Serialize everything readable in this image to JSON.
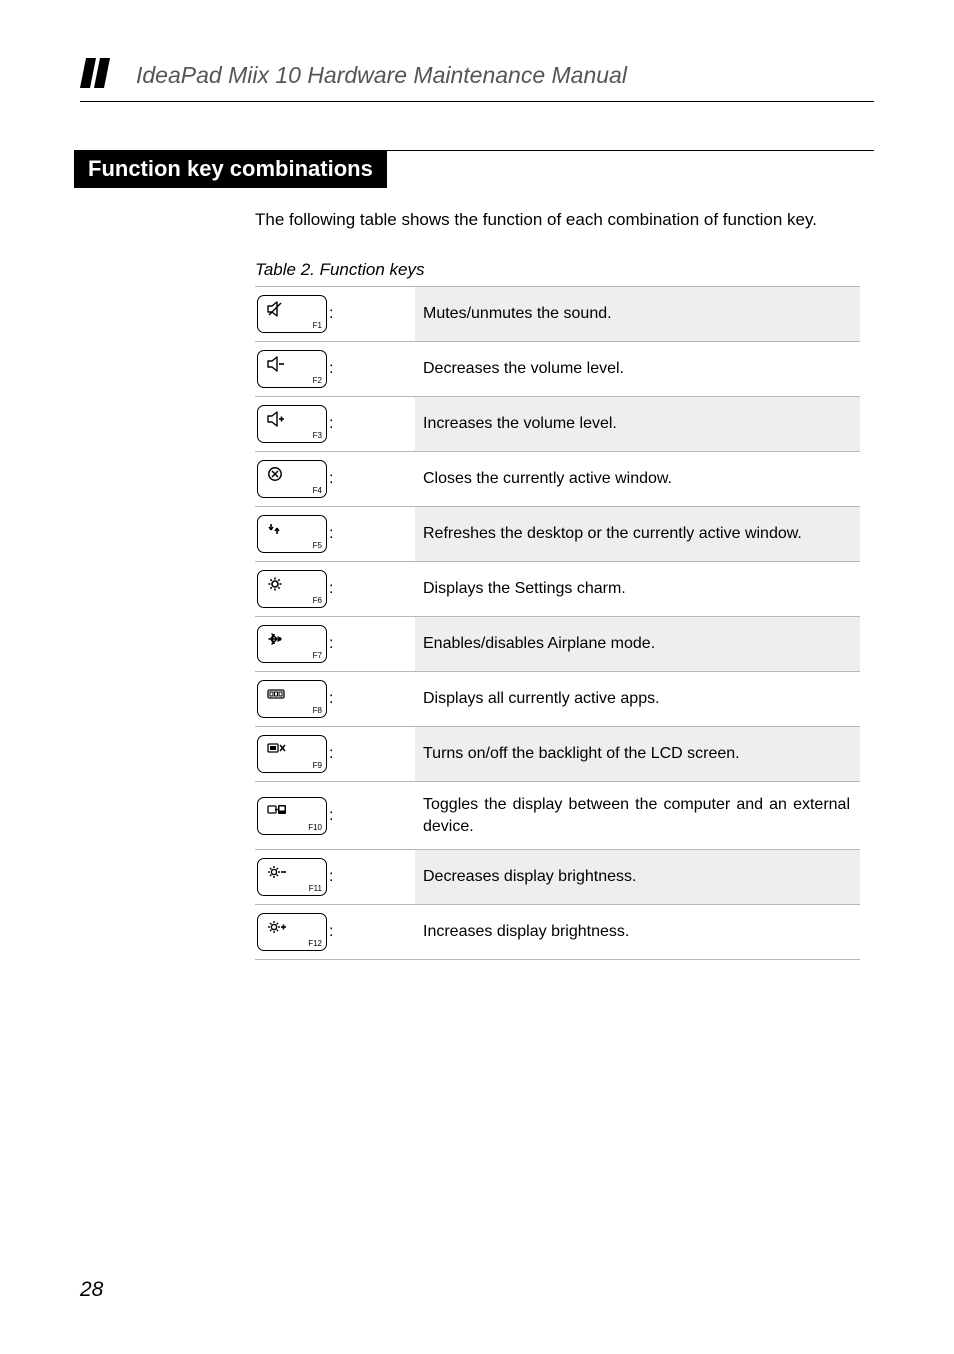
{
  "header": {
    "doc_title": "IdeaPad Miix 10 Hardware Maintenance Manual"
  },
  "section": {
    "heading": "Function key combinations",
    "intro": "The following table shows the function of each combination of function key.",
    "table_caption": "Table 2. Function keys"
  },
  "rows": [
    {
      "fn": "F1",
      "icon": "mute-icon",
      "desc": "Mutes/unmutes the sound.",
      "shaded": true,
      "colon_inside_cell": true
    },
    {
      "fn": "F2",
      "icon": "volume-down-icon",
      "desc": "Decreases the volume level.",
      "shaded": false
    },
    {
      "fn": "F3",
      "icon": "volume-up-icon",
      "desc": "Increases the volume level.",
      "shaded": true
    },
    {
      "fn": "F4",
      "icon": "close-window-icon",
      "desc": "Closes the currently active window.",
      "shaded": false
    },
    {
      "fn": "F5",
      "icon": "refresh-icon",
      "desc": "Refreshes the desktop or the currently active window.",
      "shaded": true
    },
    {
      "fn": "F6",
      "icon": "settings-gear-icon",
      "desc": "Displays the Settings charm.",
      "shaded": false
    },
    {
      "fn": "F7",
      "icon": "airplane-icon",
      "desc": "Enables/disables Airplane mode.",
      "shaded": true
    },
    {
      "fn": "F8",
      "icon": "all-apps-icon",
      "desc": "Displays all currently active apps.",
      "shaded": false
    },
    {
      "fn": "F9",
      "icon": "backlight-off-icon",
      "desc": "Turns on/off the backlight of the LCD screen.",
      "shaded": true
    },
    {
      "fn": "F10",
      "icon": "display-toggle-icon",
      "desc": "Toggles the display between the computer and an external device.",
      "shaded": false,
      "justify": true
    },
    {
      "fn": "F11",
      "icon": "brightness-down-icon",
      "desc": "Decreases display brightness.",
      "shaded": true
    },
    {
      "fn": "F12",
      "icon": "brightness-up-icon",
      "desc": "Increases display brightness.",
      "shaded": false
    }
  ],
  "page_number": "28"
}
